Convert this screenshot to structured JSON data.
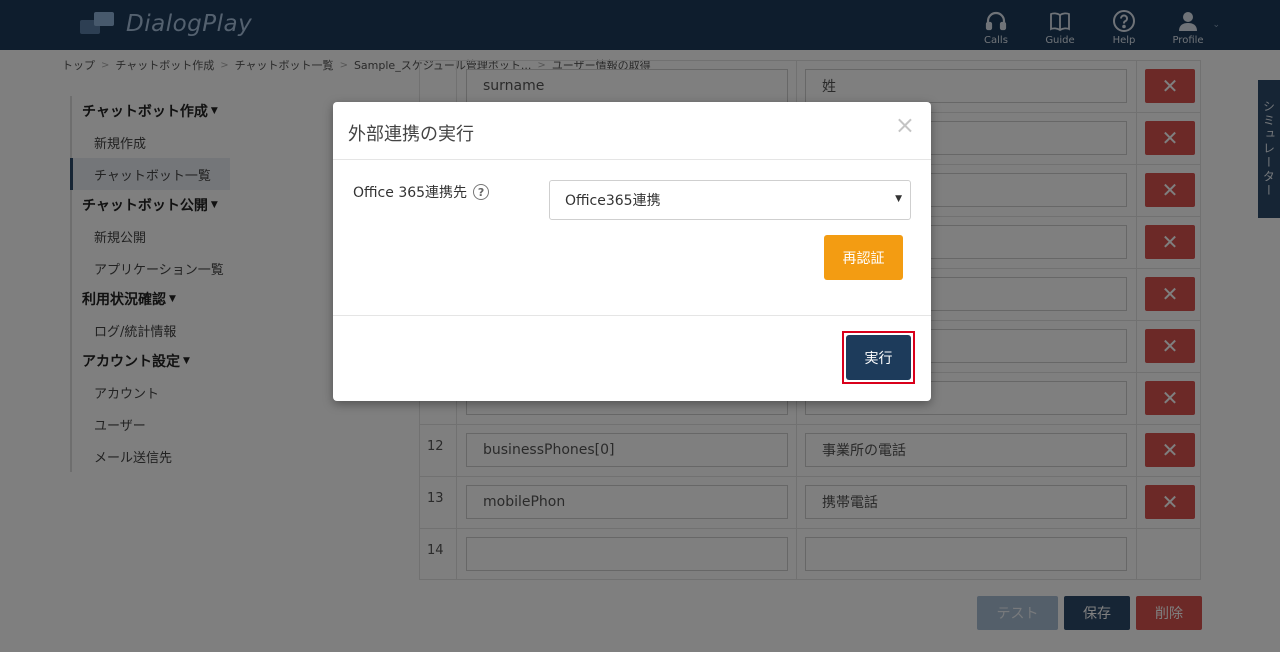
{
  "header": {
    "brand": "DialogPlay",
    "nav": [
      {
        "label": "Calls",
        "icon": "headset-icon"
      },
      {
        "label": "Guide",
        "icon": "book-icon"
      },
      {
        "label": "Help",
        "icon": "help-icon"
      },
      {
        "label": "Profile",
        "icon": "user-icon"
      }
    ]
  },
  "breadcrumb": [
    "トップ",
    "チャットボット作成",
    "チャットボット一覧",
    "Sample_スケジュール管理ボット...",
    "ユーザー情報の取得"
  ],
  "sidebar": {
    "groups": [
      {
        "title": "チャットボット作成",
        "items": [
          "新規作成",
          "チャットボット一覧"
        ]
      },
      {
        "title": "チャットボット公開",
        "items": [
          "新規公開",
          "アプリケーション一覧"
        ]
      },
      {
        "title": "利用状況確認",
        "items": [
          "ログ/統計情報"
        ]
      },
      {
        "title": "アカウント設定",
        "items": [
          "アカウント",
          "ユーザー",
          "メール送信先"
        ]
      }
    ]
  },
  "simulator_tab": "シミュレーター",
  "table": {
    "rows": [
      {
        "num": "",
        "key": "surname",
        "value": "姓"
      },
      {
        "num": "",
        "key": "",
        "value": ""
      },
      {
        "num": "",
        "key": "",
        "value": ""
      },
      {
        "num": "",
        "key": "",
        "value": ""
      },
      {
        "num": "",
        "key": "",
        "value": ""
      },
      {
        "num": "",
        "key": "",
        "value": ""
      },
      {
        "num": "",
        "key": "",
        "value": ""
      },
      {
        "num": "12",
        "key": "businessPhones[0]",
        "value": "事業所の電話"
      },
      {
        "num": "13",
        "key": "mobilePhon",
        "value": "携帯電話"
      },
      {
        "num": "14",
        "key": "",
        "value": ""
      }
    ],
    "delete_glyph": "✕"
  },
  "actions": {
    "test": "テスト",
    "save": "保存",
    "delete": "削除"
  },
  "modal": {
    "title": "外部連携の実行",
    "close": "×",
    "field_label": "Office 365連携先",
    "help": "?",
    "select_value": "Office365連携",
    "reauth": "再認証",
    "execute": "実行"
  }
}
